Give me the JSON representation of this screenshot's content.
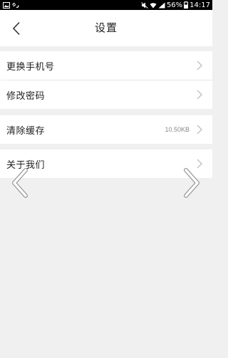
{
  "status_bar": {
    "battery": "56%",
    "time": "14:17"
  },
  "header": {
    "title": "设置"
  },
  "settings": {
    "items": [
      {
        "label": "更换手机号",
        "value": ""
      },
      {
        "label": "修改密码",
        "value": ""
      },
      {
        "label": "清除缓存",
        "value": "10.50KB"
      },
      {
        "label": "关于我们",
        "value": ""
      }
    ]
  },
  "icons": {
    "back": "chevron-left-icon",
    "row_chevron": "chevron-right-icon",
    "prev": "chevron-left-icon",
    "next": "chevron-right-icon"
  },
  "colors": {
    "background": "#f0f0f0",
    "surface": "#ffffff",
    "text": "#222222",
    "muted": "#888888",
    "chevron": "#b5b5b5"
  }
}
